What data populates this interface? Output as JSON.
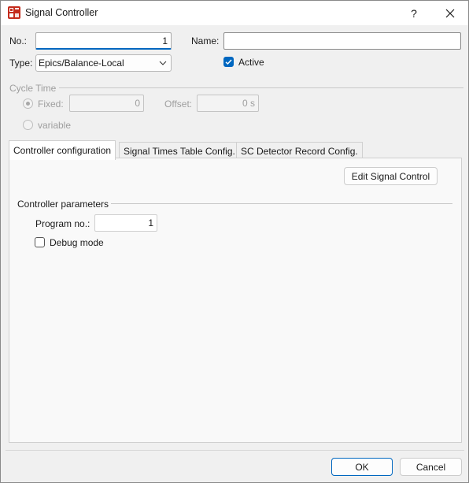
{
  "window": {
    "title": "Signal Controller",
    "help_label": "?",
    "close_label": "✕"
  },
  "form": {
    "no_label": "No.:",
    "no_value": "1",
    "name_label": "Name:",
    "name_value": "",
    "type_label": "Type:",
    "type_value": "Epics/Balance-Local",
    "active_label": "Active",
    "active_checked": true
  },
  "cycle_time": {
    "heading": "Cycle Time",
    "fixed_label": "Fixed:",
    "fixed_value": "0",
    "offset_label": "Offset:",
    "offset_value": "0 s",
    "variable_label": "variable"
  },
  "tabs": [
    {
      "label": "Controller configuration",
      "active": true
    },
    {
      "label": "Signal Times Table Config.",
      "active": false
    },
    {
      "label": "SC Detector Record Config.",
      "active": false
    }
  ],
  "panel": {
    "edit_button": "Edit Signal Control",
    "group_heading": "Controller parameters",
    "program_label": "Program no.:",
    "program_value": "1",
    "debug_label": "Debug mode",
    "debug_checked": false
  },
  "footer": {
    "ok_label": "OK",
    "cancel_label": "Cancel"
  },
  "colors": {
    "accent": "#0067c0",
    "app_icon": "#c42b1c"
  }
}
